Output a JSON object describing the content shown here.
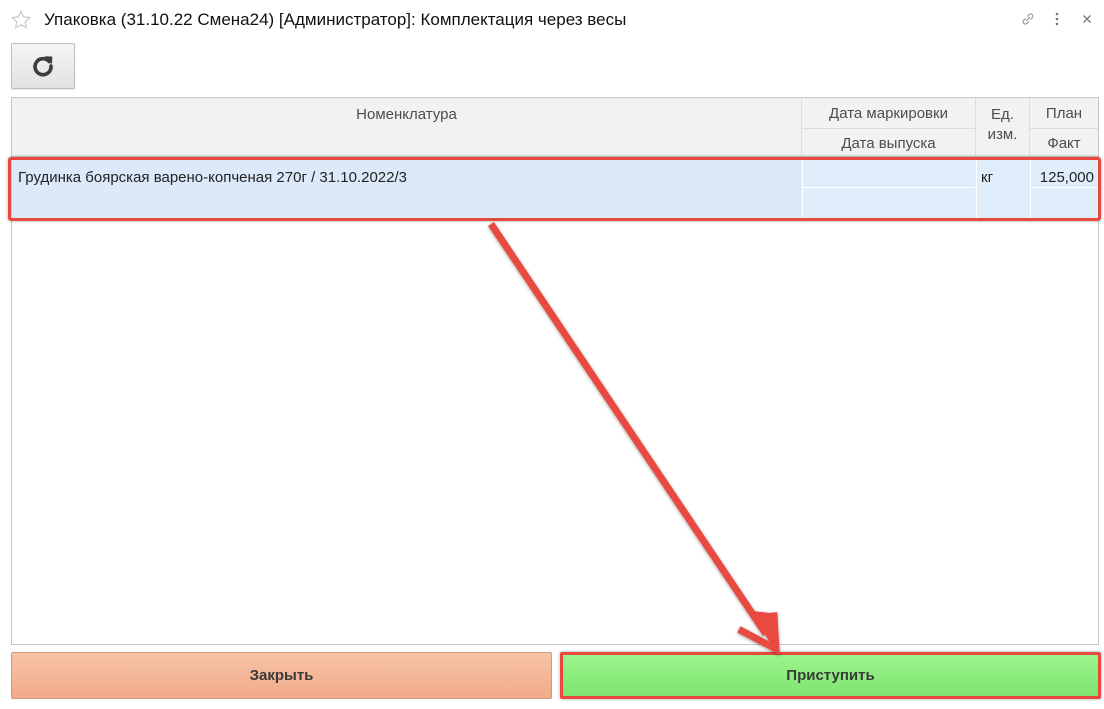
{
  "window": {
    "title": "Упаковка (31.10.22 Смена24) [Администратор]: Комплектация через весы",
    "link_icon": "link-icon",
    "more_icon": "more-vertical-icon",
    "close_icon": "close-icon",
    "favorite_icon": "star-icon"
  },
  "toolbar": {
    "refresh_icon": "refresh-icon"
  },
  "table": {
    "headers": {
      "nomenclature": "Номенклатура",
      "marking_date": "Дата маркировки",
      "release_date": "Дата выпуска",
      "unit_top": "Ед.",
      "unit_bottom": "изм.",
      "plan": "План",
      "fact": "Факт"
    },
    "rows": [
      {
        "nomenclature": "Грудинка боярская варено-копченая 270г / 31.10.2022/3",
        "marking_date": "",
        "release_date": "",
        "unit": "кг",
        "plan": "125,000",
        "fact": ""
      }
    ]
  },
  "buttons": {
    "close_label": "Закрыть",
    "start_label": "Приступить"
  },
  "colors": {
    "highlight": "#e8483f",
    "selected_row": "#e0eefb",
    "close_button": "#f2ab88",
    "start_button": "#7ee470"
  }
}
